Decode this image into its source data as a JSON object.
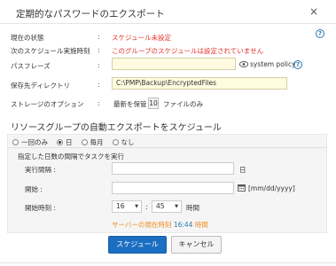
{
  "dialog": {
    "title": "定期的なパスワードのエクスポート",
    "close_label": "×",
    "help_label": "?"
  },
  "fields": {
    "status_label": "現在の状態",
    "status_value": "スケジュール未設定",
    "next_label": "次のスケジュール実施時刻",
    "next_value": "このグループのスケジュールは設定されていません",
    "passphrase_label": "パスフレーズ",
    "passphrase_value": "",
    "system_policy_label": "system policy",
    "dir_label": "保存先ディレクトリ",
    "dir_value": "C:\\PMP\\Backup\\EncryptedFiles",
    "storage_label": "ストレージのオプション",
    "storage_prefix": "最新を保管",
    "storage_count": "10",
    "storage_suffix": "ファイルのみ",
    "colon": ":"
  },
  "schedule": {
    "section_title": "リソースグループの自動エクスポートをスケジュール",
    "options": [
      "一回のみ",
      "日",
      "毎月",
      "なし"
    ],
    "selected": "日",
    "subtitle": "指定した日数の間隔でタスクを実行",
    "interval_label": "実行間隔 :",
    "interval_value": "",
    "interval_unit": "日",
    "start_label": "開始 :",
    "start_value": "",
    "date_format": "[mm/dd/yyyy]",
    "start_time_label": "開始時刻 :",
    "hour": "16",
    "minute": "45",
    "time_unit": "時間",
    "time_sep": ":",
    "server_time_prefix": "サーバーの現在時刻",
    "server_time": "16:44",
    "server_time_suffix": "時間"
  },
  "buttons": {
    "schedule": "スケジュール",
    "cancel": "キャンセル"
  },
  "colors": {
    "accent": "#1b6ec2",
    "error_text": "#e4322b",
    "input_highlight": "#fffbe0",
    "server_time": "#f08c1e"
  }
}
